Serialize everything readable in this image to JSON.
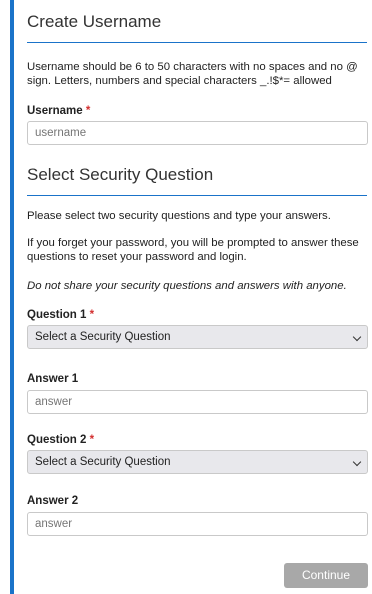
{
  "create_username": {
    "title": "Create Username",
    "description": "Username should be 6 to 50 characters with no spaces and no @ sign. Letters, numbers and special characters _.!$*= allowed",
    "username_label": "Username",
    "required_marker": "*",
    "username_placeholder": "username"
  },
  "security": {
    "title": "Select Security Question",
    "instruction": "Please select two security questions and type your answers.",
    "reset_note": "If you forget your password, you will be prompted to answer these questions to reset your password and login.",
    "warning": "Do not share your security questions and answers with anyone.",
    "question1_label": "Question 1",
    "question1_value": "Select a Security Question",
    "answer1_label": "Answer 1",
    "answer1_placeholder": "answer",
    "question2_label": "Question 2",
    "question2_value": "Select a Security Question",
    "answer2_label": "Answer 2",
    "answer2_placeholder": "answer"
  },
  "actions": {
    "continue_label": "Continue"
  },
  "colors": {
    "accent": "#1a73c9",
    "required": "#d32f2f",
    "button_disabled": "#a8a8a8"
  },
  "icons": {
    "select_chevron": "chevron-down-icon"
  }
}
